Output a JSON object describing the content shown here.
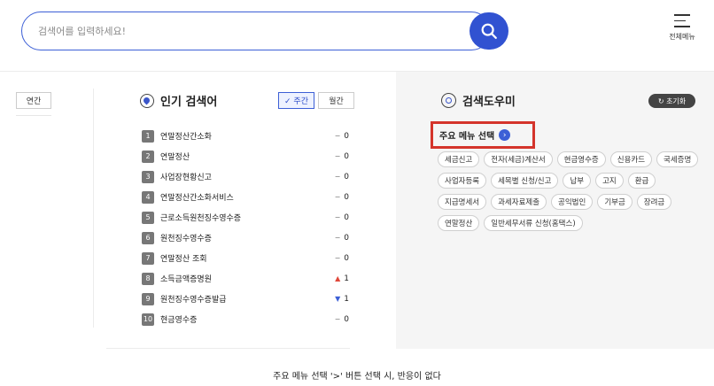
{
  "search": {
    "placeholder": "검색어를 입력하세요!",
    "menu_label": "전체메뉴"
  },
  "left": {
    "year_label": "연간"
  },
  "popular": {
    "title": "인기 검색어",
    "weekly_label": "✓ 주간",
    "monthly_label": "월간",
    "items": [
      {
        "rank": "1",
        "keyword": "연말정산간소화",
        "symbol": "−",
        "dir": "same",
        "change": "0"
      },
      {
        "rank": "2",
        "keyword": "연말정산",
        "symbol": "−",
        "dir": "same",
        "change": "0"
      },
      {
        "rank": "3",
        "keyword": "사업장현황신고",
        "symbol": "−",
        "dir": "same",
        "change": "0"
      },
      {
        "rank": "4",
        "keyword": "연말정산간소화서비스",
        "symbol": "−",
        "dir": "same",
        "change": "0"
      },
      {
        "rank": "5",
        "keyword": "근로소득원천징수영수증",
        "symbol": "−",
        "dir": "same",
        "change": "0"
      },
      {
        "rank": "6",
        "keyword": "원천징수영수증",
        "symbol": "−",
        "dir": "same",
        "change": "0"
      },
      {
        "rank": "7",
        "keyword": "연말정산 조회",
        "symbol": "−",
        "dir": "same",
        "change": "0"
      },
      {
        "rank": "8",
        "keyword": "소득금액증명원",
        "symbol": "▲",
        "dir": "up",
        "change": "1"
      },
      {
        "rank": "9",
        "keyword": "원천징수영수증발급",
        "symbol": "▼",
        "dir": "down",
        "change": "1"
      },
      {
        "rank": "10",
        "keyword": "현금영수증",
        "symbol": "−",
        "dir": "same",
        "change": "0"
      }
    ]
  },
  "helper": {
    "title": "검색도우미",
    "reset_label": "↻ 초기화",
    "menu_select_label": "주요 메뉴 선택",
    "menu_select_arrow": "›",
    "tags": [
      "세금신고",
      "전자(세금)계산서",
      "현금영수증",
      "신용카드",
      "국세증명",
      "사업자등록",
      "세목별 신청/신고",
      "납부",
      "고지",
      "환급",
      "지급명세서",
      "과세자료제출",
      "공익법인",
      "기부금",
      "장려금",
      "연말정산",
      "일반세무서류 신청(홈택스)"
    ]
  },
  "caption": "주요 메뉴 선택 '>' 버튼 선택 시, 반응이 없다",
  "colors": {
    "accent": "#3152d1",
    "highlight_border": "#d4342b",
    "panel_bg": "#f5f5f5"
  }
}
